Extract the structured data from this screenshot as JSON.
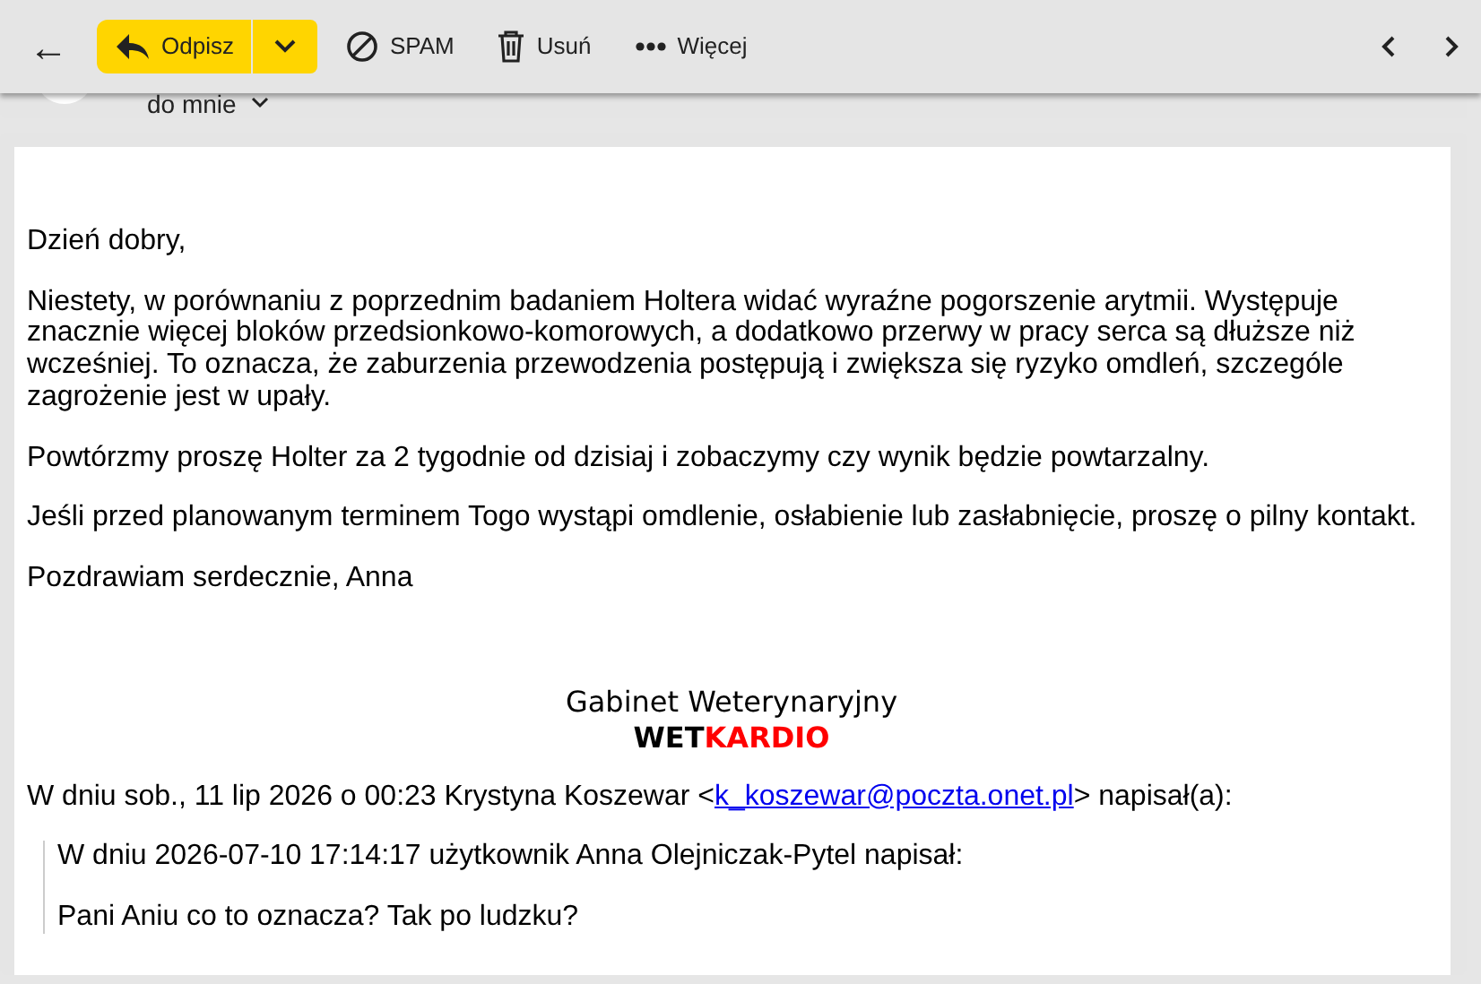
{
  "toolbar": {
    "back": "←",
    "reply": "Odpisz",
    "actions": [
      {
        "kind": "spam",
        "label": "SPAM"
      },
      {
        "kind": "delete",
        "label": "Usuń"
      },
      {
        "kind": "more",
        "label": "Więcej"
      }
    ]
  },
  "header": {
    "recipient": "do mnie"
  },
  "message": {
    "greeting": "Dzień dobry,",
    "paragraphs": [
      "Niestety, w porównaniu z poprzednim badaniem Holtera widać wyraźne pogorszenie arytmii. Występuje znacznie więcej bloków przedsionkowo-komorowych, a dodatkowo przerwy w pracy serca są dłuższe niż wcześniej. To oznacza, że zaburzenia przewodzenia postępują i zwiększa się ryzyko omdleń, szczególe zagrożenie jest w upały.",
      "Powtórzmy proszę Holter za 2 tygodnie od dzisiaj i zobaczymy czy wynik będzie powtarzalny.",
      "Jeśli przed planowanym terminem Togo wystąpi omdlenie, osłabienie lub zasłabnięcie, proszę o pilny kontakt.",
      "Pozdrawiam serdecznie, Anna"
    ],
    "signature": {
      "line": "Gabinet Weterynaryjny",
      "brand": [
        {
          "text": "WET",
          "color": "#000000"
        },
        {
          "text": "KARDIO",
          "color": "#ff0000"
        }
      ]
    },
    "quote_intro": {
      "before": "W dniu sob., 11 lip 2026 o 00:23 Krystyna Koszewar <",
      "link": "k_koszewar@poczta.onet.pl",
      "after": "> napisał(a):"
    },
    "quoted": [
      "W dniu 2026-07-10 17:14:17 użytkownik Anna Olejniczak-Pytel napisał:",
      "Pani Aniu co to oznacza? Tak po ludzku?"
    ]
  }
}
